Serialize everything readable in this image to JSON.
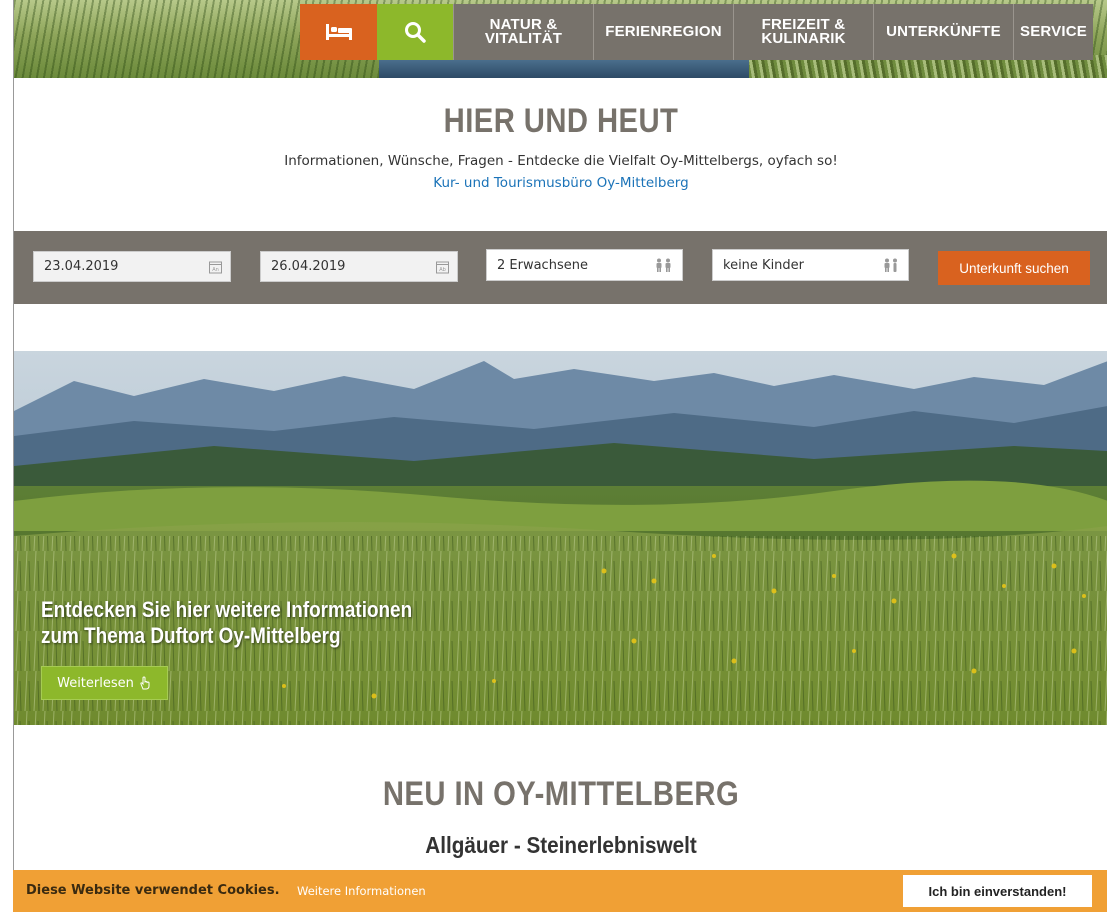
{
  "nav": {
    "items": [
      {
        "label_line1": "NATUR &",
        "label_line2": "VITALITÄT"
      },
      {
        "label": "FERIENREGION"
      },
      {
        "label_line1": "FREIZEIT &",
        "label_line2": "KULINARIK"
      },
      {
        "label": "UNTERKÜNFTE"
      },
      {
        "label": "SERVICE"
      }
    ],
    "bed_icon": "bed-icon",
    "search_icon": "search-icon"
  },
  "intro": {
    "title": "HIER UND HEUT",
    "text": "Informationen, Wünsche, Fragen - Entdecke die Vielfalt Oy-Mittelbergs, oyfach so!",
    "link": "Kur- und Tourismusbüro Oy-Mittelberg"
  },
  "booking": {
    "arrival": "23.04.2019",
    "arrival_icon_label": "An",
    "departure": "26.04.2019",
    "departure_icon_label": "Ab",
    "adults": "2 Erwachsene",
    "children": "keine Kinder",
    "search_button": "Unterkunft suchen"
  },
  "hero": {
    "caption_line1": "Entdecken Sie hier weitere Informationen",
    "caption_line2": "zum Thema Duftort Oy-Mittelberg",
    "button": "Weiterlesen"
  },
  "new_section": {
    "title": "NEU IN OY-MITTELBERG",
    "subtitle": "Allgäuer - Steinerlebniswelt"
  },
  "cookie": {
    "text": "Diese Website verwendet Cookies.",
    "link": "Weitere Informationen",
    "accept": "Ich bin einverstanden!"
  },
  "colors": {
    "nav_gray": "#77726b",
    "orange": "#d9621f",
    "green": "#8db82b",
    "link_blue": "#1b73b8",
    "cookie_orange": "#f0a035"
  }
}
